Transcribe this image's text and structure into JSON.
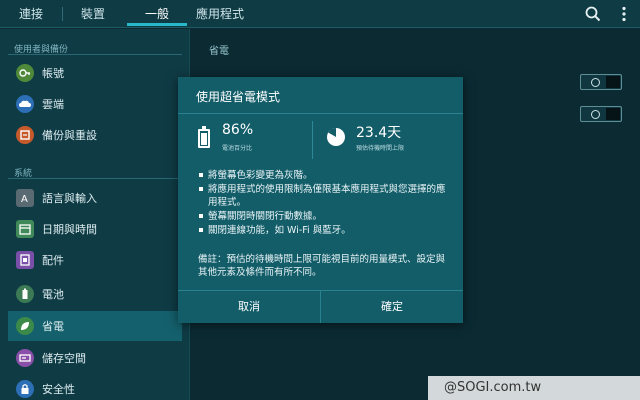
{
  "tabs": [
    {
      "label": "連接"
    },
    {
      "label": "裝置"
    },
    {
      "label": "一般"
    },
    {
      "label": "應用程式"
    }
  ],
  "sidebar": {
    "sections": [
      {
        "title": "使用者與備份"
      },
      {
        "title": "系統"
      }
    ],
    "items": [
      {
        "label": "帳號",
        "icon": "key-icon",
        "color": "#4f8a3a"
      },
      {
        "label": "雲端",
        "icon": "cloud-icon",
        "color": "#2d6fb6"
      },
      {
        "label": "備份與重設",
        "icon": "backup-icon",
        "color": "#c75a2a"
      },
      {
        "label": "語言與輸入",
        "icon": "language-icon",
        "color": "#5a6a72"
      },
      {
        "label": "日期與時間",
        "icon": "calendar-icon",
        "color": "#3f8a58"
      },
      {
        "label": "配件",
        "icon": "accessory-icon",
        "color": "#7a4fa8"
      },
      {
        "label": "電池",
        "icon": "battery-icon",
        "color": "#3b7a54"
      },
      {
        "label": "省電",
        "icon": "power-saving-icon",
        "color": "#3b8a4a"
      },
      {
        "label": "儲存空間",
        "icon": "storage-icon",
        "color": "#8a4fa8"
      },
      {
        "label": "安全性",
        "icon": "lock-icon",
        "color": "#2d6fb6"
      }
    ]
  },
  "main": {
    "title": "省電"
  },
  "dialog": {
    "title": "使用超省電模式",
    "battery_percent": "86%",
    "battery_label": "電池百分比",
    "standby_time": "23.4天",
    "standby_label": "預估待機時間上限",
    "bullets": [
      "將螢幕色彩變更為灰階。",
      "將應用程式的使用限制為僅限基本應用程式與您選擇的應用程式。",
      "螢幕關閉時關閉行動數據。",
      "關閉連線功能，如 Wi-Fi 與藍牙。"
    ],
    "note": "備註：預估的待機時間上限可能視目前的用量模式、設定與其他元素及條件而有所不同。",
    "cancel_label": "取消",
    "confirm_label": "確定"
  },
  "watermark": "@SOGI.com.tw",
  "colors": {
    "accent": "#27b9c9",
    "dialog_bg": "#135d69",
    "sidebar_bg": "#0f3b45"
  }
}
